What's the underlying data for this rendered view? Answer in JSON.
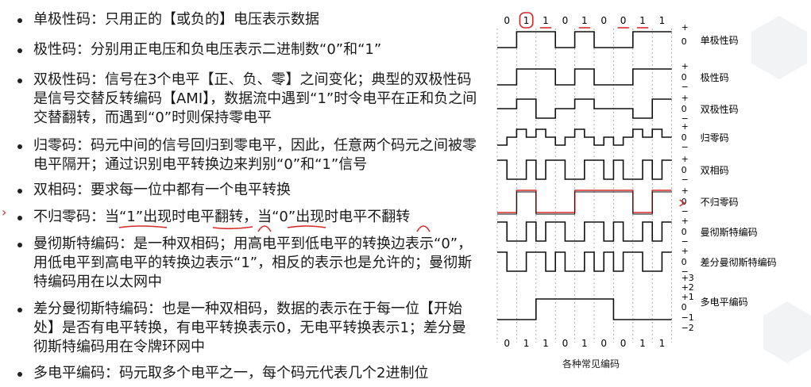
{
  "bullets": [
    {
      "text": "单极性码：只用正的【或负的】电压表示数据"
    },
    {
      "text": "极性码：分别用正电压和负电压表示二进制数“0”和“1”"
    },
    {
      "text": "双极性码：信号在3个电平【正、负、零】之间变化；典型的双极性码是信号交替反转编码【AMI】，数据流中遇到“1”时令电平在正和负之间交替翻转，而遇到“0”时则保持零电平"
    },
    {
      "text": "归零码：码元中间的信号回归到零电平，因此，任意两个码元之间被零电平隔开；通过识别电平转换边来判别“0”和“1”信号"
    },
    {
      "text": "双相码：要求每一位中都有一个电平转换"
    },
    {
      "text": "不归零码：当“1”出现时电平翻转，当“0”出现时电平不翻转"
    },
    {
      "text": "曼彻斯特编码：是一种双相码；用高电平到低电平的转换边表示“0”，用低电平到高电平的转换边表示“1”，相反的表示也是允许的；曼彻斯特编码用在以太网中"
    },
    {
      "text": "差分曼彻斯特编码：也是一种双相码，数据的表示在于每一位【开始处】是否有电平转换，有电平转换表示0，无电平转换表示1；差分曼彻斯特编码用在令牌环网中"
    },
    {
      "text": "多电平编码：码元取多个电平之一，每个码元代表几个2进制位"
    }
  ],
  "figure": {
    "bits": [
      "0",
      "1",
      "1",
      "0",
      "1",
      "0",
      "0",
      "1",
      "1"
    ],
    "rows": [
      {
        "name": "单极性码",
        "levels": [
          "+",
          "0"
        ]
      },
      {
        "name": "极性码",
        "levels": [
          "+",
          "0",
          "−"
        ]
      },
      {
        "name": "双极性码",
        "levels": [
          "+",
          "0",
          "−"
        ]
      },
      {
        "name": "归零码",
        "levels": [
          "+",
          "0",
          "−"
        ]
      },
      {
        "name": "双相码",
        "levels": [
          "+",
          "0",
          "−"
        ]
      },
      {
        "name": "不归零码",
        "levels": [
          "+",
          "0",
          "−"
        ]
      },
      {
        "name": "曼彻斯特编码",
        "levels": [
          "+",
          "0",
          "−"
        ]
      },
      {
        "name": "差分曼彻斯特编码",
        "levels": [
          "+",
          "0",
          "−"
        ]
      },
      {
        "name": "多电平编码",
        "levels": [
          "+3",
          "+2",
          "+1",
          "0",
          "−1",
          "−2"
        ]
      }
    ],
    "caption": "各种常见编码",
    "annotation_color": "#d62b2b"
  }
}
